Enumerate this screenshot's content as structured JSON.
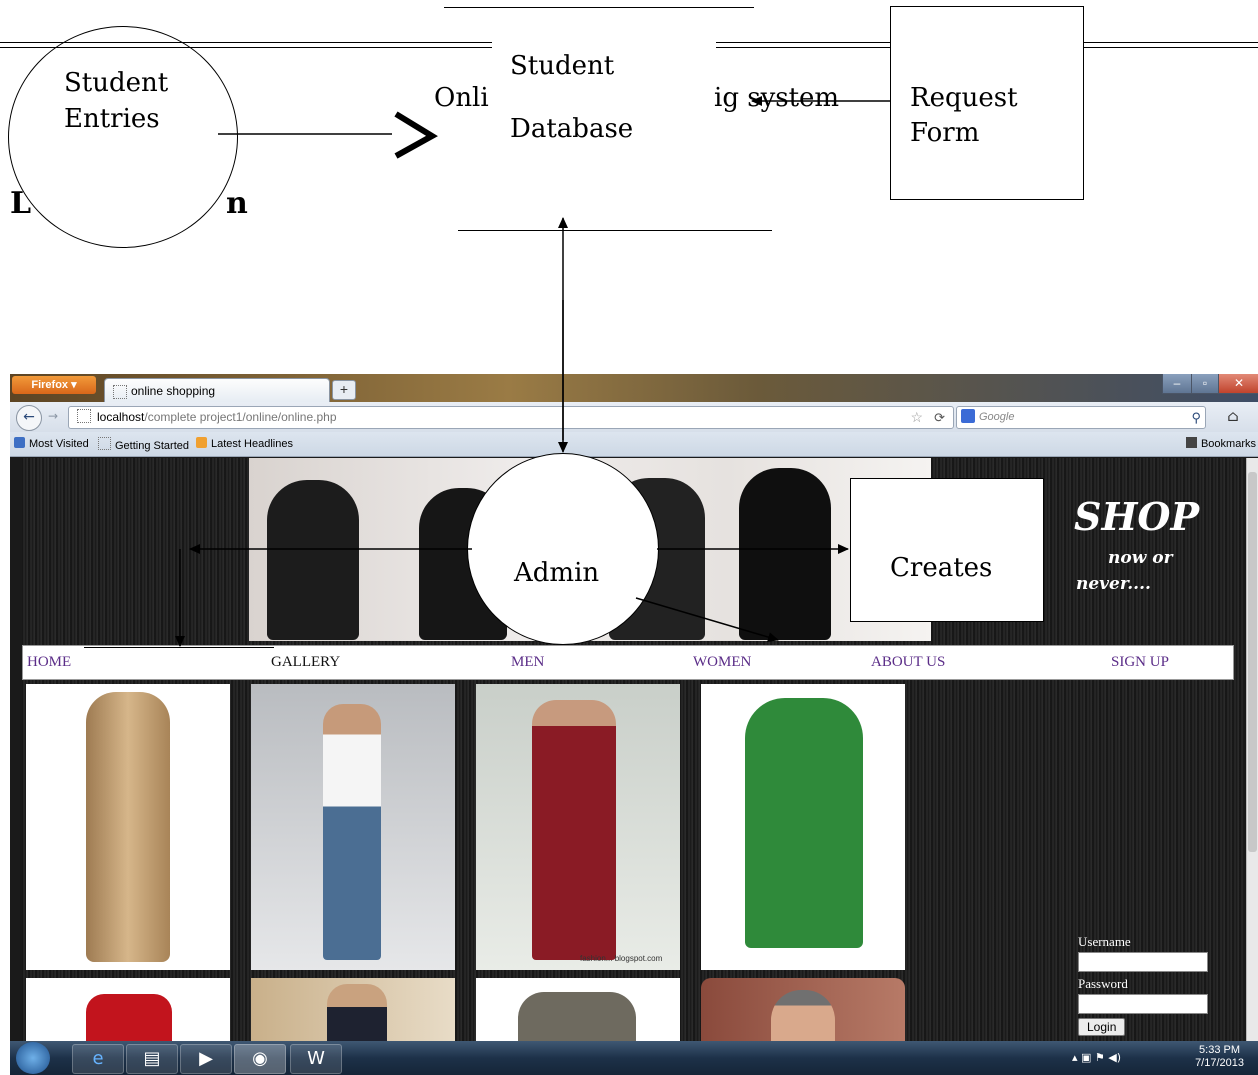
{
  "diagram": {
    "student_entries": [
      "Student",
      "Entries"
    ],
    "student_database": [
      "Student",
      "Database"
    ],
    "request_form": [
      "Request",
      "Form"
    ],
    "admin": "Admin",
    "creates": "Creates",
    "obscured_title_left": "Onli",
    "obscured_title_right": "ig system",
    "obscured_heading_left": "L",
    "obscured_heading_right": "n"
  },
  "browser": {
    "app_button": "Firefox",
    "tab_title": "online shopping",
    "new_tab": "+",
    "url_host": "localhost",
    "url_path": "/complete project1/online/online.php",
    "search_placeholder": "Google",
    "bookmarks": [
      "Most Visited",
      "Getting Started",
      "Latest Headlines"
    ],
    "bookmarks_menu": "Bookmarks"
  },
  "site": {
    "shop_title": "SHOP",
    "shop_sub1": "now or",
    "shop_sub2": "never....",
    "menu": [
      "HOME",
      "GALLERY",
      "MEN",
      "WOMEN",
      "ABOUT US",
      "SIGN UP"
    ],
    "login": {
      "username_label": "Username",
      "password_label": "Password",
      "button": "Login"
    },
    "photo_watermark": "fashion... blogspot.com"
  },
  "taskbar": {
    "time": "5:33 PM",
    "date": "7/17/2013"
  },
  "colors": {
    "menu_link": "#5b2d88",
    "firefox_orange": "#e57a26"
  }
}
